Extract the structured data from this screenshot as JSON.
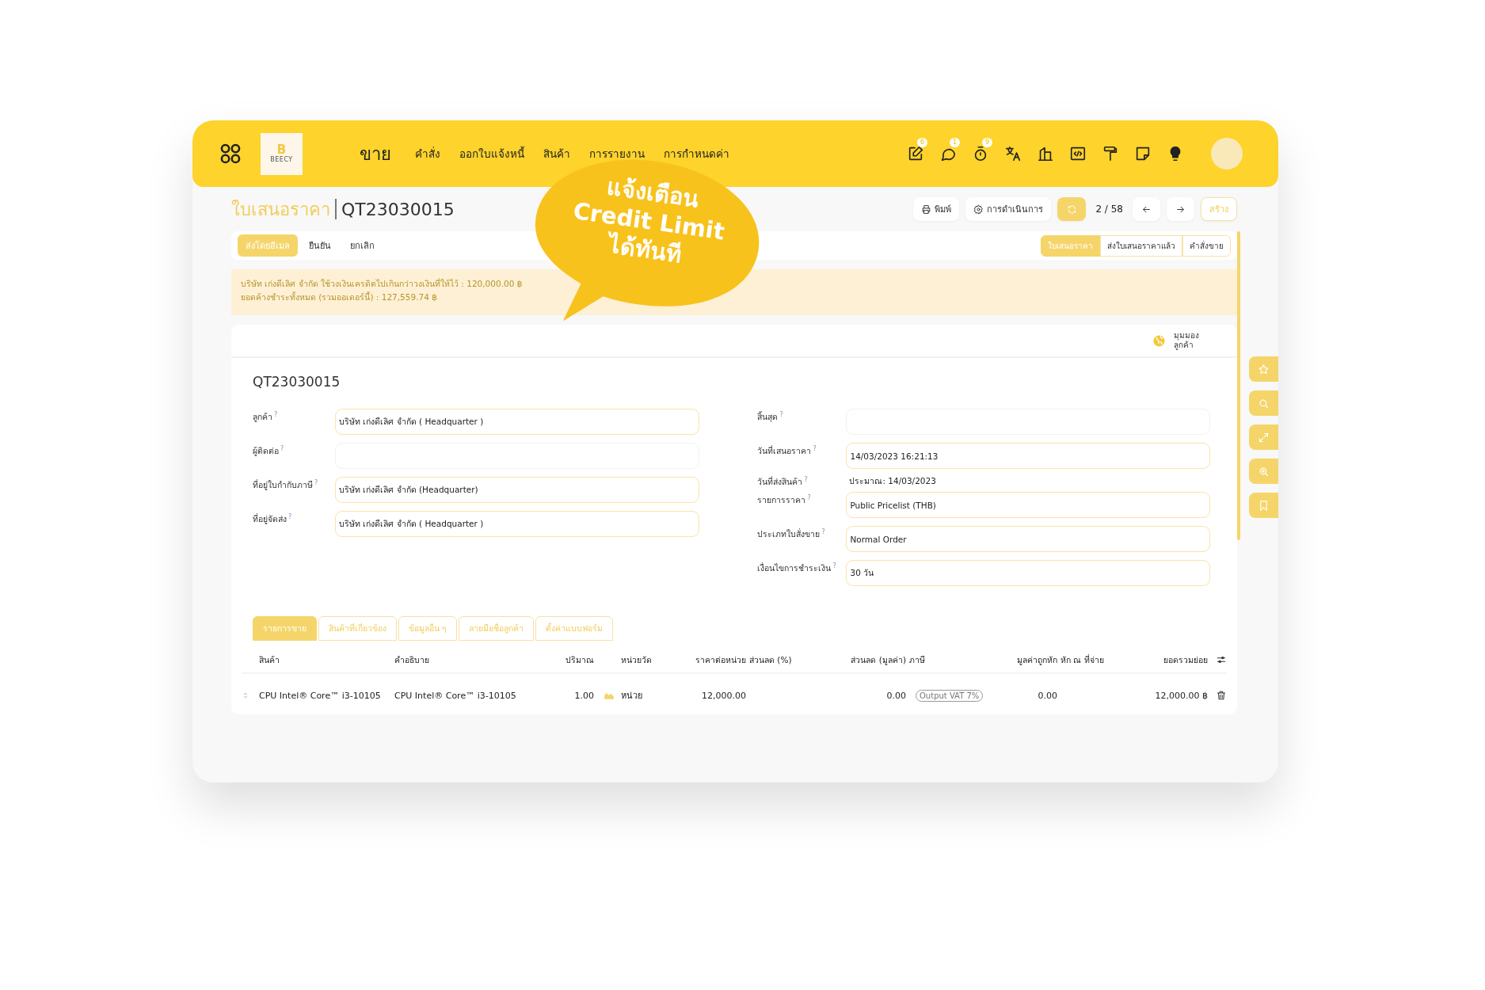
{
  "header": {
    "logo": {
      "mark": "B",
      "name": "BEECY"
    },
    "app_title": "ขาย",
    "menu": [
      {
        "label": "คำสั่ง"
      },
      {
        "label": "ออกใบแจ้งหนี้"
      },
      {
        "label": "สินค้า"
      },
      {
        "label": "การรายงาน"
      },
      {
        "label": "การกำหนดค่า"
      }
    ],
    "toolbar_icons": [
      {
        "kind": "activity",
        "badge": "6"
      },
      {
        "kind": "chat",
        "badge": "1"
      },
      {
        "kind": "timer",
        "badge": "9"
      },
      {
        "kind": "translate"
      },
      {
        "kind": "company"
      },
      {
        "kind": "code"
      },
      {
        "kind": "paint"
      },
      {
        "kind": "note"
      },
      {
        "kind": "bulb"
      }
    ]
  },
  "breadcrumb": {
    "parent": "ใบเสนอราคา",
    "current": "QT23030015"
  },
  "actions": {
    "print": "พิมพ์",
    "action": "การดำเนินการ",
    "pager": "2 / 58",
    "create": "สร้าง"
  },
  "status_buttons": [
    {
      "label": "ส่งโดยอีเมล",
      "primary": true
    },
    {
      "label": "ยืนยัน",
      "primary": false
    },
    {
      "label": "ยกเลิก",
      "primary": false
    }
  ],
  "stages": [
    {
      "label": "ใบเสนอราคา",
      "selected": true
    },
    {
      "label": "ส่งใบเสนอราคาแล้ว",
      "selected": false
    },
    {
      "label": "คำสั่งขาย",
      "selected": false
    }
  ],
  "alert": [
    "บริษัท เก่งดีเลิศ จำกัด ใช้วงเงินเครดิตไปเกินกว่าวงเงินที่ให้ไว้ : 120,000.00 ฿",
    "ยอดค้างชำระทั้งหมด (รวมออเดอร์นี้) : 127,559.74 ฿"
  ],
  "sheet": {
    "customer_preview": "มุมมอง ลูกค้า",
    "title": "QT23030015",
    "left_fields": [
      {
        "kind": "input",
        "label": "ลูกค้า",
        "help": "?",
        "value": "บริษัท เก่งดีเลิศ จำกัด  ( Headquarter )"
      },
      {
        "kind": "input",
        "label": "ผู้ติดต่อ",
        "help": "?"
      },
      {
        "kind": "input",
        "label": "ที่อยู่ใบกำกับภาษี",
        "help": "?",
        "value": "บริษัท เก่งดีเลิศ จำกัด (Headquarter)"
      },
      {
        "kind": "input",
        "label": "ที่อยู่จัดส่ง",
        "help": "?",
        "value": "บริษัท เก่งดีเลิศ จำกัด  ( Headquarter )"
      }
    ],
    "right_fields": [
      {
        "kind": "input",
        "label": "สิ้นสุด",
        "help": "?"
      },
      {
        "kind": "input",
        "label": "วันที่เสนอราคา",
        "help": "?",
        "value": "14/03/2023 16:21:13"
      },
      {
        "kind": "text",
        "label": "วันที่ส่งสินค้า",
        "help": "?",
        "value": "ประมาณ:  14/03/2023"
      },
      {
        "kind": "input",
        "label": "รายการราคา",
        "help": "?",
        "value": "Public Pricelist (THB)"
      },
      {
        "kind": "input",
        "label": "ประเภทใบสั่งขาย",
        "help": "?",
        "value": "Normal Order"
      },
      {
        "kind": "input",
        "label": "เงื่อนไขการชำระเงิน",
        "help": "?",
        "value": "30 วัน"
      }
    ],
    "tabs": [
      {
        "label": "รายการขาย",
        "selected": true
      },
      {
        "label": "สินค้าที่เกี่ยวข้อง",
        "selected": false
      },
      {
        "label": "ข้อมูลอื่น ๆ",
        "selected": false
      },
      {
        "label": "ลายมือชื่อลูกค้า",
        "selected": false
      },
      {
        "label": "ตั้งค่าแบบฟอร์ม",
        "selected": false
      }
    ],
    "table": {
      "columns": [
        "สินค้า",
        "คำอธิบาย",
        "ปริมาณ",
        "หน่วยวัด",
        "ราคาต่อหน่วย",
        "ส่วนลด (%)",
        "ส่วนลด (มูลค่า)",
        "ภาษี",
        "มูลค่าถูกหัก",
        "หัก ณ ที่จ่าย",
        "ยอดรวมย่อย"
      ],
      "rows": [
        {
          "product": "CPU Intel® Core™ i3-10105",
          "description": "CPU Intel® Core™ i3-10105",
          "quantity": "1.00",
          "unit": "หน่วย",
          "unit_price": "12,000.00",
          "discount_amount": "0.00",
          "tax": "Output VAT 7%",
          "deducted": "0.00",
          "subtotal": "12,000.00 ฿"
        }
      ]
    }
  },
  "callout": {
    "lines": [
      "แจ้งเตือน",
      "Credit Limit",
      "ได้ทันที"
    ]
  }
}
